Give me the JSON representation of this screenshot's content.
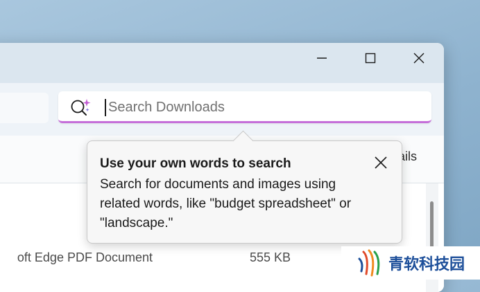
{
  "window": {
    "controls": {
      "minimize": "minimize-icon",
      "maximize": "maximize-icon",
      "close": "close-icon"
    }
  },
  "search": {
    "placeholder": "Search Downloads",
    "value": "",
    "icon": "ai-search-icon",
    "accent": "#c56fd9"
  },
  "toolbar": {
    "details_label": "ails"
  },
  "files": [
    {
      "type": "oft Edge PDF Document",
      "size": "555 KB"
    }
  ],
  "tooltip": {
    "title": "Use your own words to search",
    "body": "Search for documents and images using related words, like \"budget spreadsheet\" or \"landscape.\"",
    "close_icon": "close-icon"
  },
  "watermark": {
    "text": "青软科技园"
  }
}
